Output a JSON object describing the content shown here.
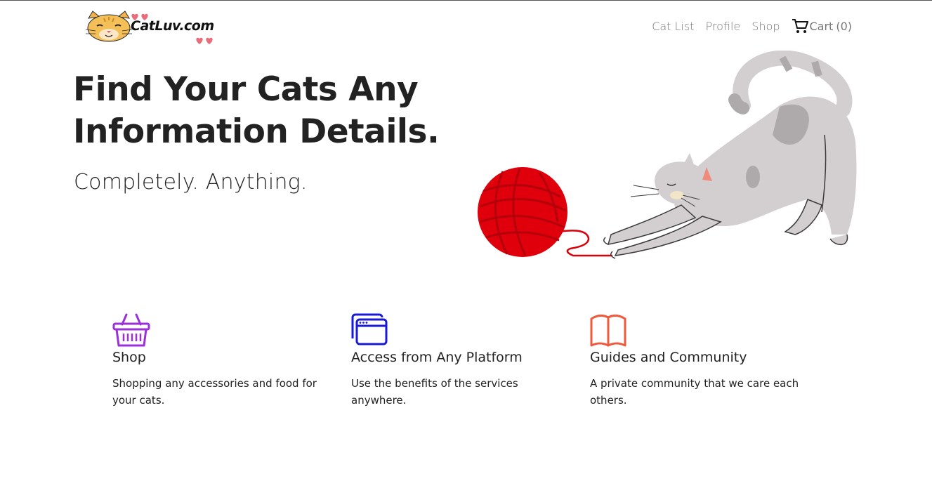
{
  "brand": {
    "logo_text": "CatLuv.com",
    "logo_icon": "cat-face-icon"
  },
  "nav": {
    "links": [
      "Cat List",
      "Profile",
      "Shop"
    ],
    "cart_label": "Cart",
    "cart_count": "(0)",
    "cart_icon": "shopping-cart-icon"
  },
  "hero": {
    "title_line1": "Find Your Cats Any",
    "title_line2": "Information Details.",
    "subtitle": "Completely. Anything.",
    "illustration": "cat-stretching-with-yarn-ball"
  },
  "features": [
    {
      "icon": "shopping-basket-icon",
      "color": "#9b30d9",
      "title": "Shop",
      "description": "Shopping any accessories and food for your cats."
    },
    {
      "icon": "browser-window-icon",
      "color": "#1a1ad6",
      "title": "Access from Any Platform",
      "description": "Use the benefits of the services anywhere."
    },
    {
      "icon": "open-book-icon",
      "color": "#f05a3c",
      "title": "Guides and Community",
      "description": "A private community that we care each others."
    }
  ],
  "colors": {
    "yarn": "#e0000b",
    "cat_body": "#d3cfd1",
    "cat_spots": "#aeaaab"
  }
}
